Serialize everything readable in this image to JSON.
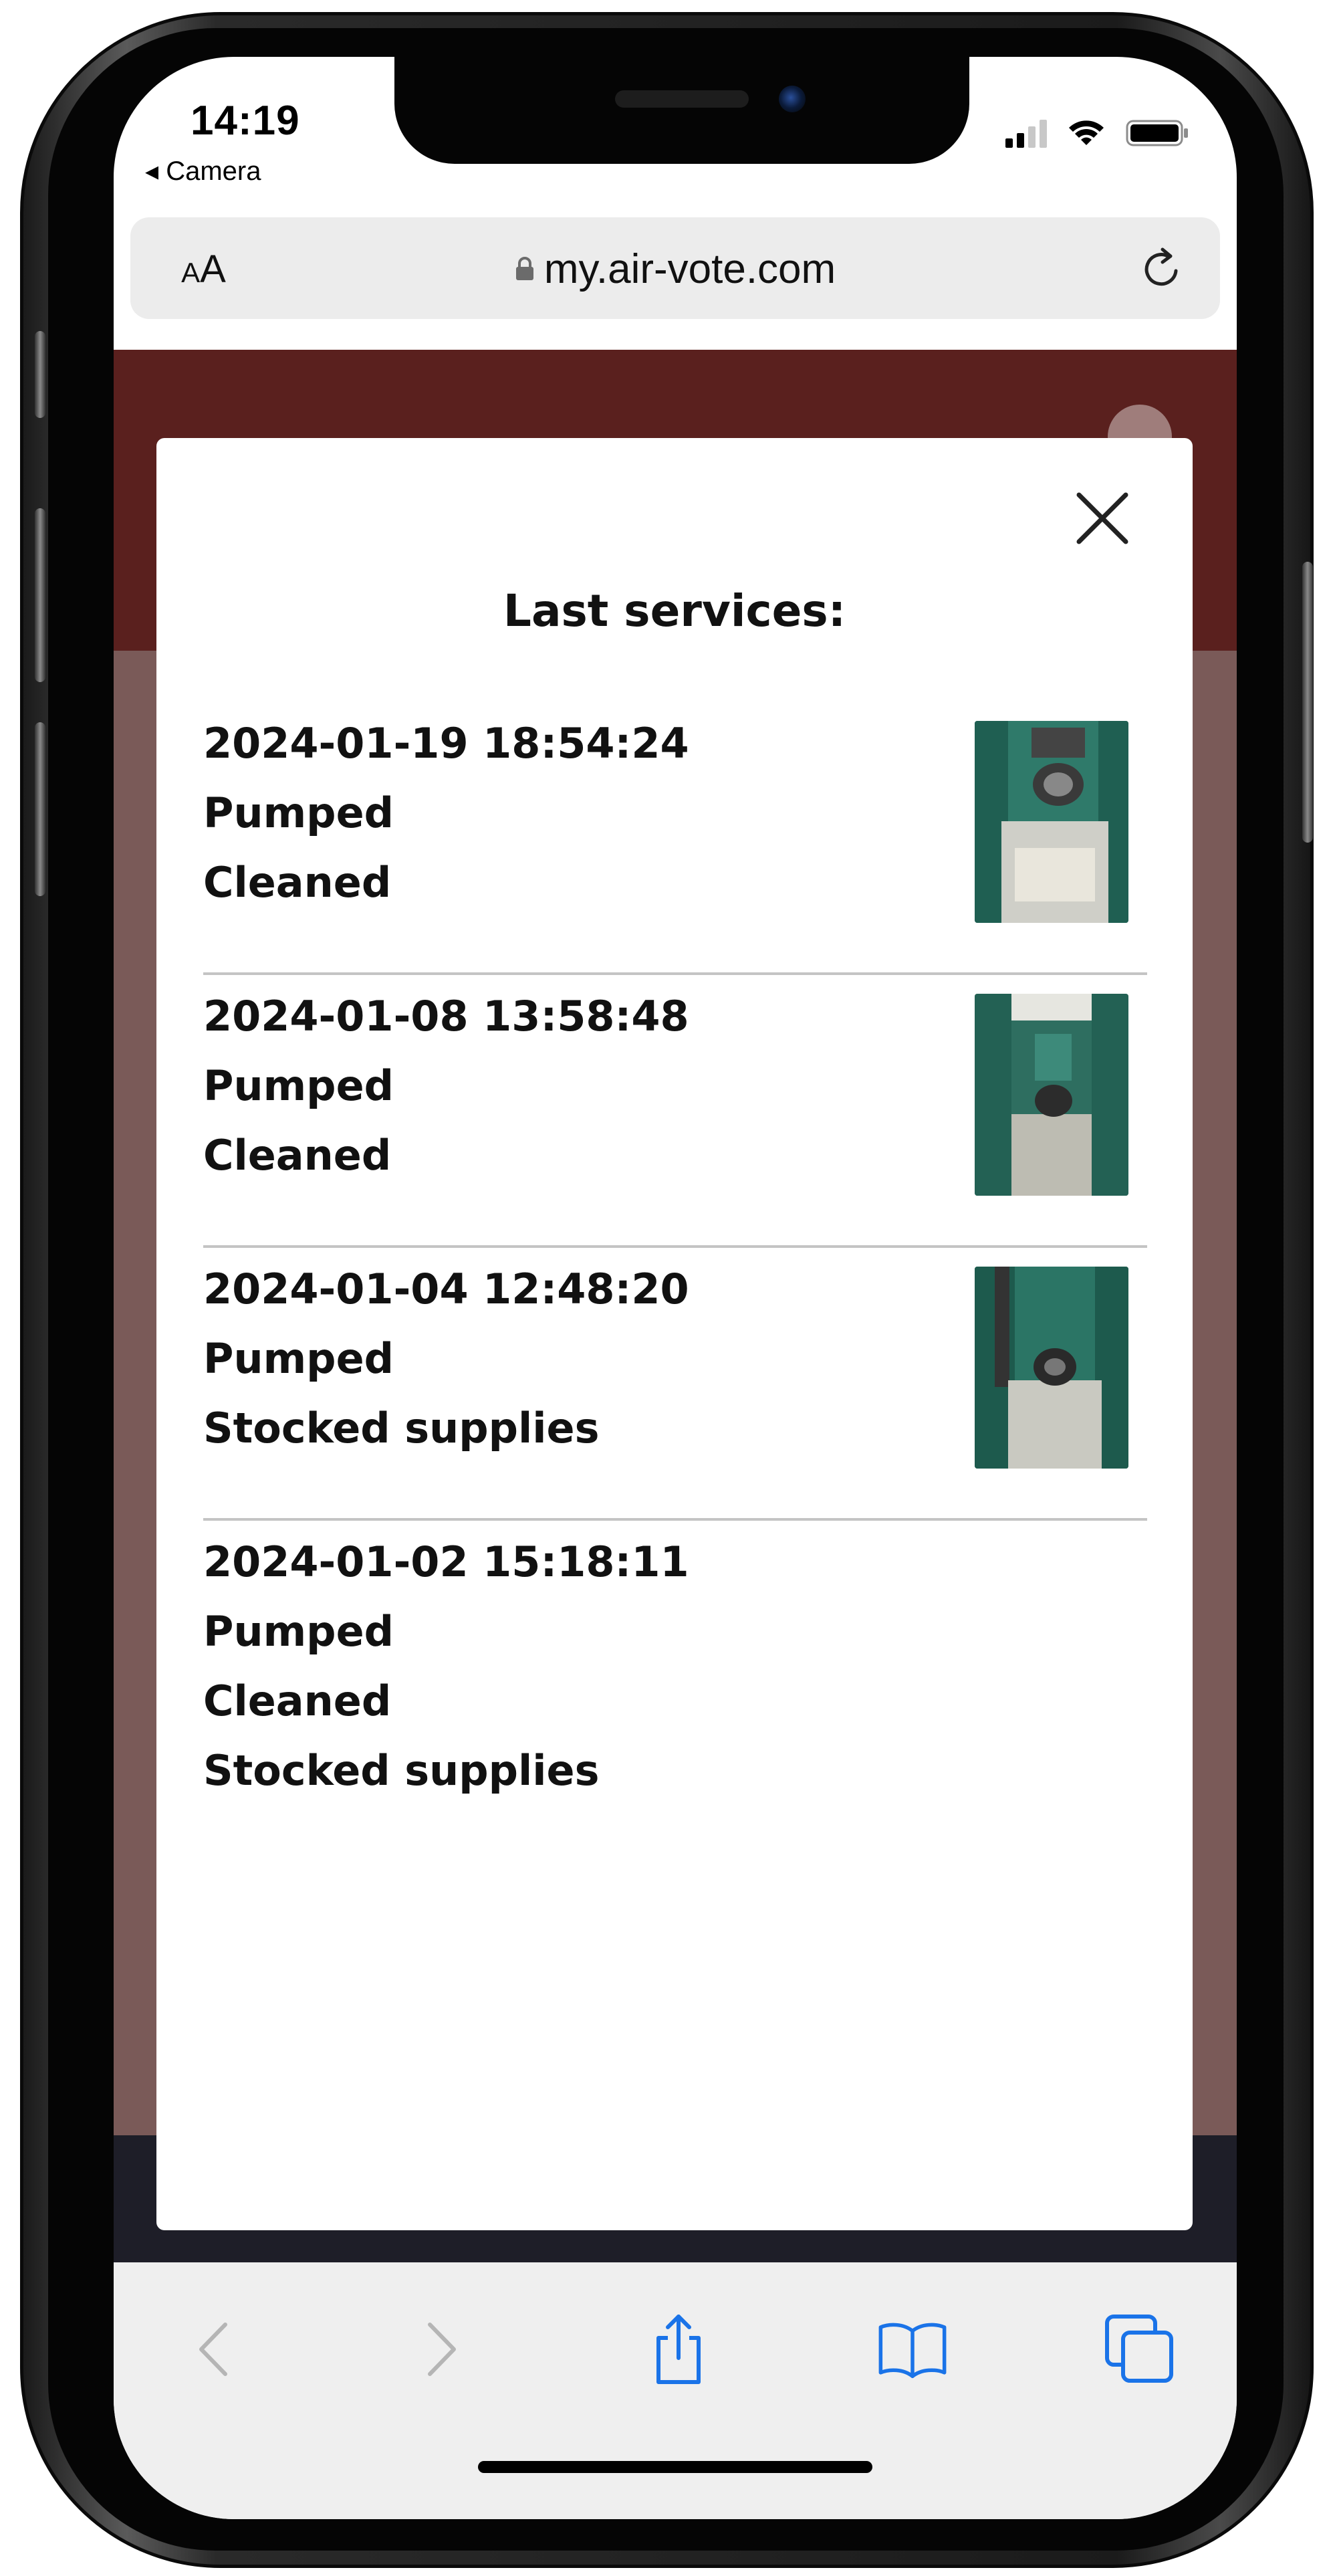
{
  "status_bar": {
    "time": "14:19",
    "back_app": "◂ Camera"
  },
  "browser": {
    "text_size_label": "AA",
    "url": "my.air-vote.com",
    "lock_icon": "lock-icon",
    "reload_icon": "reload-icon"
  },
  "modal": {
    "title": "Last services:",
    "close_icon": "close-icon",
    "services": [
      {
        "timestamp": "2024-01-19 18:54:24",
        "actions": [
          "Pumped",
          "Cleaned"
        ],
        "has_photo": true
      },
      {
        "timestamp": "2024-01-08 13:58:48",
        "actions": [
          "Pumped",
          "Cleaned"
        ],
        "has_photo": true
      },
      {
        "timestamp": "2024-01-04 12:48:20",
        "actions": [
          "Pumped",
          "Stocked supplies"
        ],
        "has_photo": true
      },
      {
        "timestamp": "2024-01-02 15:18:11",
        "actions": [
          "Pumped",
          "Cleaned",
          "Stocked supplies"
        ],
        "has_photo": false
      }
    ]
  },
  "toolbar": {
    "icons": [
      "back-icon",
      "forward-icon",
      "share-icon",
      "bookmarks-icon",
      "tabs-icon"
    ]
  },
  "colors": {
    "header": "#5a201e",
    "page_overlay": "#7a5a58",
    "footer": "#1e1e28",
    "toolbar_icon": "#1a73e8",
    "toolbar_icon_disabled": "#b5b5b5"
  }
}
